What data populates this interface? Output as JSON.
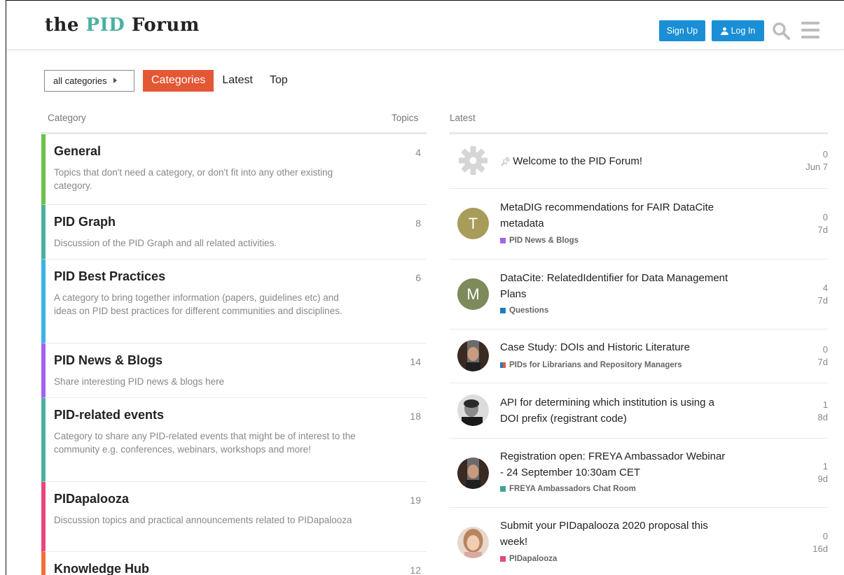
{
  "header": {
    "logo_the": "the ",
    "logo_pid": "PID",
    "logo_forum": " Forum",
    "signup_label": "Sign Up",
    "login_label": "Log In",
    "brand_color": "#4cb0a1",
    "button_color": "#1a8fd6"
  },
  "nav": {
    "dropdown_label": "all categories",
    "tabs": [
      {
        "label": "Categories",
        "active": true
      },
      {
        "label": "Latest",
        "active": false
      },
      {
        "label": "Top",
        "active": false
      }
    ],
    "active_color": "#e45735"
  },
  "left": {
    "col_category": "Category",
    "col_topics": "Topics",
    "categories": [
      {
        "name": "General",
        "count": "4",
        "color": "#6cc04a",
        "desc": "Topics that don't need a category, or don't fit into any other existing category."
      },
      {
        "name": "PID Graph",
        "count": "8",
        "color": "#4cb0a1",
        "desc": "Discussion of the PID Graph and all related activities."
      },
      {
        "name": "PID Best Practices",
        "count": "6",
        "color": "#3ab4e6",
        "desc": "A category to bring together information (papers, guidelines etc) and ideas on PID best practices for different communities and disciplines."
      },
      {
        "name": "PID News & Blogs",
        "count": "14",
        "color": "#a461ef",
        "desc": "Share interesting PID news & blogs here"
      },
      {
        "name": "PID-related events",
        "count": "18",
        "color": "#4cb0a1",
        "desc": "Category to share any PID-related events that might be of interest to the community e.g. conferences, webinars, workshops and more!"
      },
      {
        "name": "PIDapalooza",
        "count": "19",
        "color": "#e9477b",
        "desc": "Discussion topics and practical announcements related to PIDapalooza"
      },
      {
        "name": "Knowledge Hub",
        "count": "12",
        "color": "#f0703a",
        "desc": ""
      }
    ]
  },
  "right": {
    "col_latest": "Latest",
    "topics": [
      {
        "title": "Welcome to the PID Forum!",
        "pinned": true,
        "category": "",
        "cat_color": "",
        "replies": "0",
        "age": "Jun 7",
        "avatar": "gear-icon"
      },
      {
        "title": "MetaDIG recommendations for FAIR DataCite metadata",
        "category": "PID News & Blogs",
        "cat_color": "#a461ef",
        "replies": "0",
        "age": "7d",
        "avatar_letter": "T",
        "avatar_color": "#a89c5b"
      },
      {
        "title": "DataCite: RelatedIdentifier for Data Management Plans",
        "category": "Questions",
        "cat_color": "#1a7ec2",
        "replies": "4",
        "age": "7d",
        "avatar_letter": "M",
        "avatar_color": "#7d8a5a"
      },
      {
        "title": "Case Study: DOIs and Historic Literature",
        "category": "PIDs for Librarians and Repository Managers",
        "cat_color": "#e45735",
        "replies": "0",
        "age": "7d",
        "avatar": "photo"
      },
      {
        "title": "API for determining which institution is using a DOI prefix (registrant code)",
        "category": "",
        "cat_color": "",
        "replies": "1",
        "age": "8d",
        "avatar": "photo"
      },
      {
        "title": "Registration open: FREYA Ambassador Webinar - 24 September 10:30am CET",
        "category": "FREYA Ambassadors Chat Room",
        "cat_color": "#3ba39b",
        "replies": "1",
        "age": "9d",
        "avatar": "photo"
      },
      {
        "title": "Submit your PIDapalooza 2020 proposal this week!",
        "category": "PIDapalooza",
        "cat_color": "#e9477b",
        "replies": "0",
        "age": "16d",
        "avatar": "photo"
      }
    ]
  }
}
